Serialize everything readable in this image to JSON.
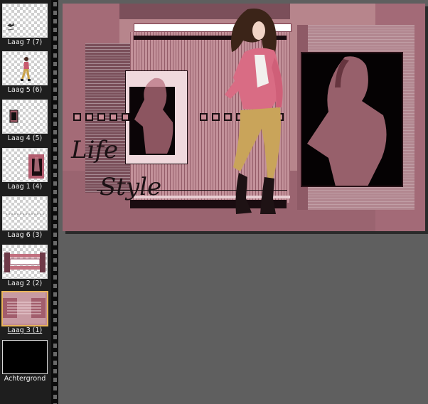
{
  "layers_panel": {
    "items": [
      {
        "label": "Laag 7 (7)",
        "selected": false,
        "content": "small-element"
      },
      {
        "label": "Laag 5 (6)",
        "selected": false,
        "content": "figure"
      },
      {
        "label": "Laag 4 (5)",
        "selected": false,
        "content": "small-frame"
      },
      {
        "label": "Laag 1 (4)",
        "selected": false,
        "content": "frame-figure"
      },
      {
        "label": "Laag 6 (3)",
        "selected": false,
        "content": "dotted-line"
      },
      {
        "label": "Laag 2 (2)",
        "selected": false,
        "content": "bars"
      },
      {
        "label": "Laag 3 (1)",
        "selected": true,
        "content": "pink-background"
      },
      {
        "label": "Achtergrond",
        "selected": false,
        "content": "black"
      }
    ]
  },
  "canvas": {
    "text_line1": "Life",
    "text_line2": "Style"
  },
  "colors": {
    "workspace": "#5f5f5f",
    "panel": "#1e1e1e",
    "canvas_pink": "#b88089",
    "dark_mauve": "#6e4450",
    "selection": "#e9b45a"
  }
}
